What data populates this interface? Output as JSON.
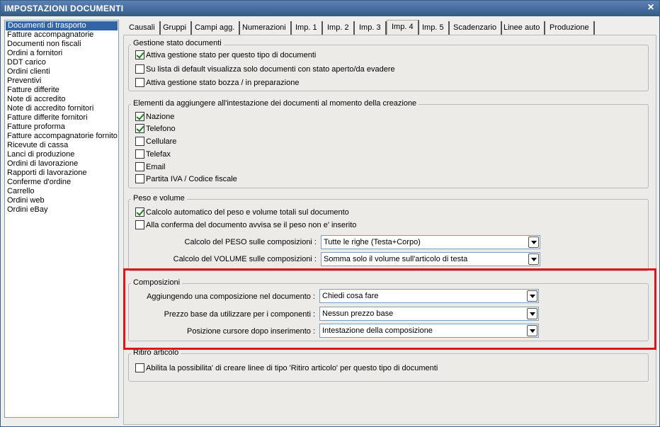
{
  "window": {
    "title": "IMPOSTAZIONI DOCUMENTI",
    "close_glyph": "×"
  },
  "left_list": {
    "items": [
      "Documenti di trasporto",
      "Fatture accompagnatorie",
      "Documenti non fiscali",
      "Ordini a fornitori",
      "DDT carico",
      "Ordini clienti",
      "Preventivi",
      "Fatture differite",
      "Note di accredito",
      "Note di accredito fornitori",
      "Fatture differite fornitori",
      "Fatture proforma",
      "Fatture accompagnatorie fornito",
      "Ricevute di cassa",
      "Lanci di produzione",
      "Ordini di lavorazione",
      "Rapporti di lavorazione",
      "Conferme d'ordine",
      "Carrello",
      "Ordini web",
      "Ordini eBay"
    ],
    "selected_index": 0
  },
  "tabs": [
    "Causali",
    "Gruppi",
    "Campi agg.",
    "Numerazioni",
    "Imp. 1",
    "Imp. 2",
    "Imp. 3",
    "Imp. 4",
    "Imp. 5",
    "Scadenzario",
    "Linee auto",
    "Produzione"
  ],
  "active_tab": "Imp. 4",
  "gestione_stato": {
    "title": "Gestione stato documenti",
    "options": [
      {
        "label": "Attiva gestione stato per questo tipo di documenti",
        "checked": true
      },
      {
        "label": "Su lista di default visualizza solo documenti con stato aperto/da evadere",
        "checked": false
      },
      {
        "label": "Attiva gestione stato bozza / in preparazione",
        "checked": false
      }
    ]
  },
  "elementi": {
    "title": "Elementi da aggiungere all'intestazione dei documenti al momento della creazione",
    "options": [
      {
        "label": "Nazione",
        "checked": true
      },
      {
        "label": "Telefono",
        "checked": true
      },
      {
        "label": "Cellulare",
        "checked": false
      },
      {
        "label": "Telefax",
        "checked": false
      },
      {
        "label": "Email",
        "checked": false
      },
      {
        "label": "Partita IVA / Codice fiscale",
        "checked": false
      }
    ]
  },
  "peso_volume": {
    "title": "Peso e volume",
    "options": [
      {
        "label": "Calcolo automatico del peso e volume totali sul documento",
        "checked": true
      },
      {
        "label": "Alla conferma del documento avvisa se il peso non e' inserito",
        "checked": false
      }
    ],
    "peso_label": "Calcolo del PESO sulle composizioni :",
    "peso_value": "Tutte le righe (Testa+Corpo)",
    "volume_label": "Calcolo del VOLUME sulle composizioni :",
    "volume_value": "Somma solo il volume sull'articolo di testa"
  },
  "composizioni": {
    "title": "Composizioni",
    "aggiungendo_label": "Aggiungendo una composizione nel documento :",
    "aggiungendo_value": "Chiedi cosa fare",
    "prezzo_label": "Prezzo base da utilizzare per i componenti :",
    "prezzo_value": "Nessun prezzo base",
    "posizione_label": "Posizione cursore dopo inserimento :",
    "posizione_value": "Intestazione della composizione"
  },
  "ritiro": {
    "title": "Ritiro articolo",
    "option": {
      "label": "Abilita la possibilita' di creare linee di tipo 'Ritiro articolo' per questo tipo di documenti",
      "checked": false
    }
  },
  "colors": {
    "highlight": "#e0141c",
    "titlebar": "#34598a",
    "selection": "#3165a5",
    "check": "#1a7d1a"
  }
}
